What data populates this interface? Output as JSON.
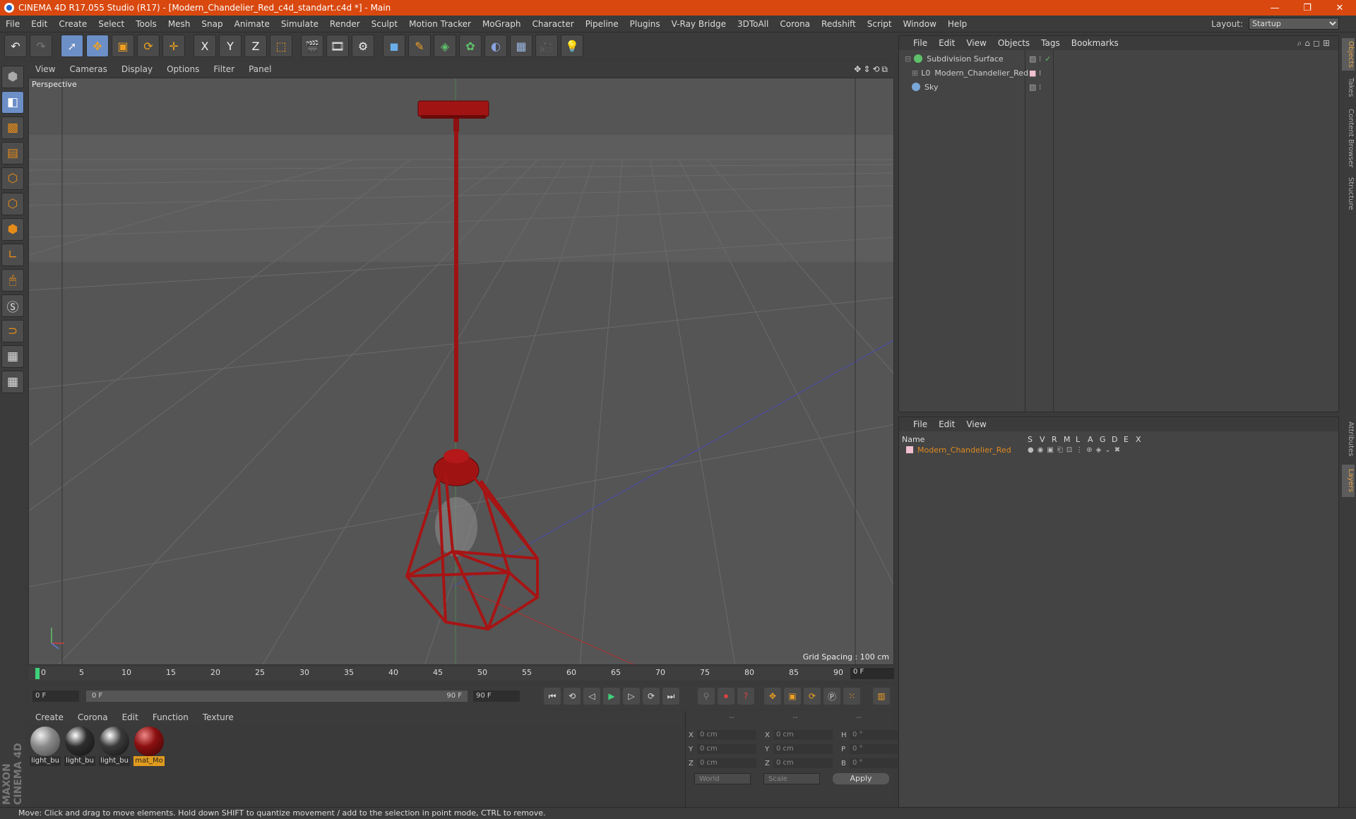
{
  "app": {
    "title": "CINEMA 4D R17.055 Studio (R17) - [Modern_Chandelier_Red_c4d_standart.c4d *] - Main",
    "window_controls": {
      "minimize": "—",
      "restore": "❐",
      "close": "✕"
    }
  },
  "menubar": {
    "items": [
      "File",
      "Edit",
      "Create",
      "Select",
      "Tools",
      "Mesh",
      "Snap",
      "Animate",
      "Simulate",
      "Render",
      "Sculpt",
      "Motion Tracker",
      "MoGraph",
      "Character",
      "Pipeline",
      "Plugins",
      "V-Ray Bridge",
      "3DToAll",
      "Corona",
      "Redshift",
      "Script",
      "Window",
      "Help"
    ],
    "layout_label": "Layout:",
    "layout_value": "Startup"
  },
  "toolbar": {
    "x": "X",
    "y": "Y",
    "z": "Z"
  },
  "viewport": {
    "menu": [
      "View",
      "Cameras",
      "Display",
      "Options",
      "Filter",
      "Panel"
    ],
    "label": "Perspective",
    "grid_spacing": "Grid Spacing : 100 cm"
  },
  "timeline": {
    "ticks": [
      "0",
      "5",
      "10",
      "15",
      "20",
      "25",
      "30",
      "35",
      "40",
      "45",
      "50",
      "55",
      "60",
      "65",
      "70",
      "75",
      "80",
      "85",
      "90"
    ],
    "current_frame": "0 F"
  },
  "playbar": {
    "start": "0 F",
    "range_start": "0 F",
    "range_end": "90 F",
    "end": "90 F"
  },
  "material_manager": {
    "menu": [
      "Create",
      "Corona",
      "Edit",
      "Function",
      "Texture"
    ],
    "materials": [
      {
        "name": "light_bu",
        "color": "#8a8a8a"
      },
      {
        "name": "light_bu",
        "color": "#2e2e2e"
      },
      {
        "name": "light_bu",
        "color": "#3a3a3a"
      },
      {
        "name": "mat_Mo",
        "color": "#8b1010",
        "selected": true
      }
    ]
  },
  "coordinates": {
    "header": [
      "--",
      "--",
      "--"
    ],
    "rows": [
      {
        "a": "X",
        "av": "0 cm",
        "b": "X",
        "bv": "0 cm",
        "c": "H",
        "cv": "0 °"
      },
      {
        "a": "Y",
        "av": "0 cm",
        "b": "Y",
        "bv": "0 cm",
        "c": "P",
        "cv": "0 °"
      },
      {
        "a": "Z",
        "av": "0 cm",
        "b": "Z",
        "bv": "0 cm",
        "c": "B",
        "cv": "0 °"
      }
    ],
    "world": "World",
    "scale": "Scale",
    "apply": "Apply"
  },
  "object_manager": {
    "menu": [
      "File",
      "Edit",
      "View",
      "Objects",
      "Tags",
      "Bookmarks"
    ],
    "objects": [
      {
        "name": "Subdivision Surface",
        "icon_color": "#5fc06a"
      },
      {
        "name": "Modern_Chandelier_Red",
        "icon_color": "#cccccc"
      },
      {
        "name": "Sky",
        "icon_color": "#7aa6d8"
      }
    ]
  },
  "layer_manager": {
    "menu": [
      "File",
      "Edit",
      "View"
    ],
    "columns": [
      "Name",
      "S",
      "V",
      "R",
      "M",
      "L",
      "A",
      "G",
      "D",
      "E",
      "X"
    ],
    "layers": [
      {
        "name": "Modern_Chandelier_Red",
        "color": "#e08a1e"
      }
    ]
  },
  "right_tabs": [
    "Objects",
    "Takes",
    "Content Browser",
    "Structure",
    "Attributes",
    "Layers"
  ],
  "status": "Move: Click and drag to move elements. Hold down SHIFT to quantize movement / add to the selection in point mode, CTRL to remove.",
  "logo_text": "MAXON CINEMA 4D"
}
